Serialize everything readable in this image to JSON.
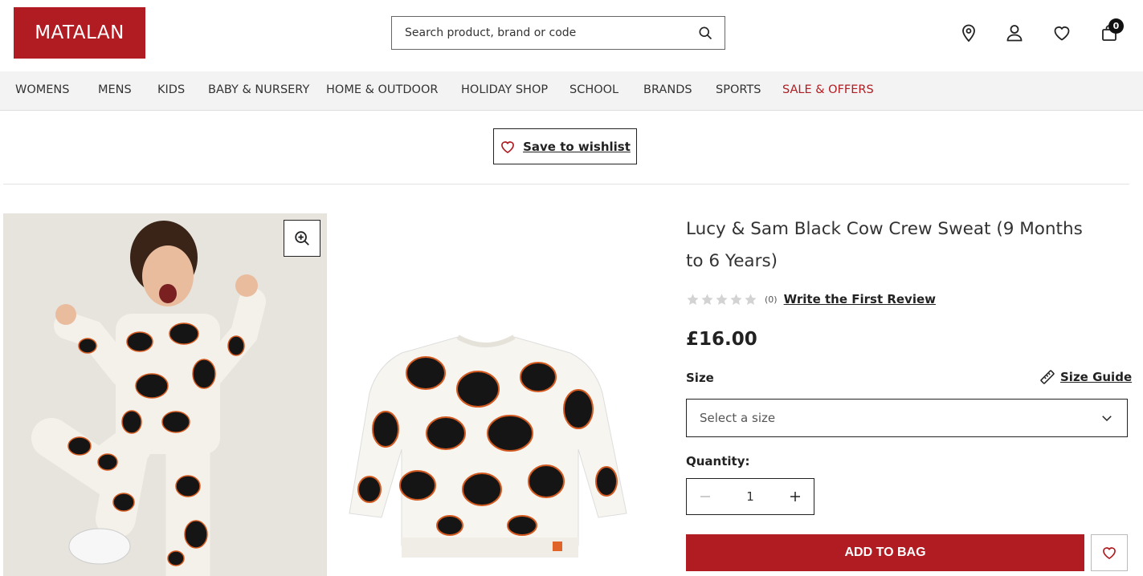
{
  "header": {
    "logo": "MATALAN",
    "search_placeholder": "Search product, brand or code",
    "bag_count": "0"
  },
  "nav": {
    "items": [
      "WOMENS",
      "MENS",
      "KIDS",
      "BABY & NURSERY",
      "HOME & OUTDOOR",
      "HOLIDAY SHOP",
      "SCHOOL",
      "BRANDS",
      "SPORTS",
      "SALE & OFFERS"
    ]
  },
  "wishlist_top": {
    "label": "Save to wishlist"
  },
  "product": {
    "title": "Lucy & Sam Black Cow Crew Sweat (9 Months to 6 Years)",
    "rating_count": "(0)",
    "review_link": "Write the First Review",
    "price": "£16.00",
    "size_label": "Size",
    "size_guide": "Size Guide",
    "size_select_value": "Select a size",
    "quantity_label": "Quantity:",
    "quantity": "1",
    "add_to_bag": "ADD TO BAG"
  },
  "colors": {
    "brand": "#b01c22",
    "nav_bg": "#f3f3f3"
  },
  "icons": [
    "search-icon",
    "location-pin-icon",
    "user-icon",
    "heart-icon",
    "bag-icon",
    "zoom-in-icon",
    "star-icon",
    "ruler-icon",
    "chevron-down-icon",
    "minus-icon",
    "plus-icon"
  ]
}
